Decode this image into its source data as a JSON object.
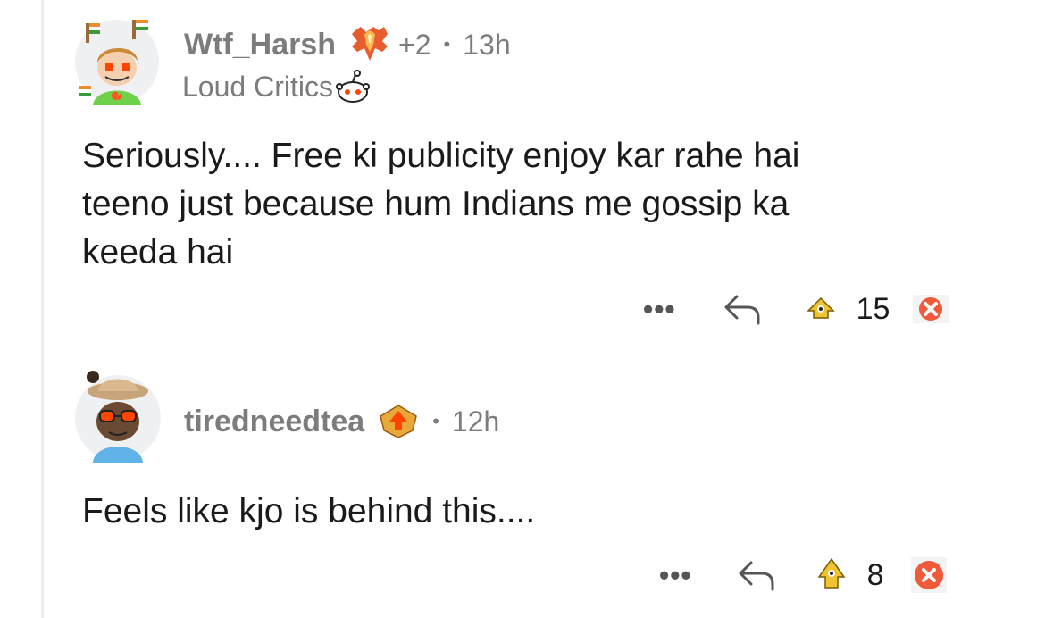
{
  "comments": [
    {
      "username": "Wtf_Harsh",
      "award_count": "+2",
      "dot": "•",
      "time": "13h",
      "flair": "Loud Critics",
      "text_lines": [
        "Seriously.... Free ki publicity enjoy kar rahe hai",
        "teeno just because hum Indians me gossip ka",
        "keeda hai"
      ],
      "more": "•••",
      "score": "15"
    },
    {
      "username": "tiredneedtea",
      "dot": "•",
      "time": "12h",
      "text_lines": [
        "Feels like kjo is behind this...."
      ],
      "more": "•••",
      "score": "8"
    }
  ],
  "icons": {
    "reply": "reply-arrow-icon",
    "upvote": "upvote-award-icon",
    "downvote": "downvote-x-icon"
  },
  "colors": {
    "downvote": "#ee5a3a",
    "upvote": "#f1c232",
    "meta": "#7c7c7c"
  }
}
